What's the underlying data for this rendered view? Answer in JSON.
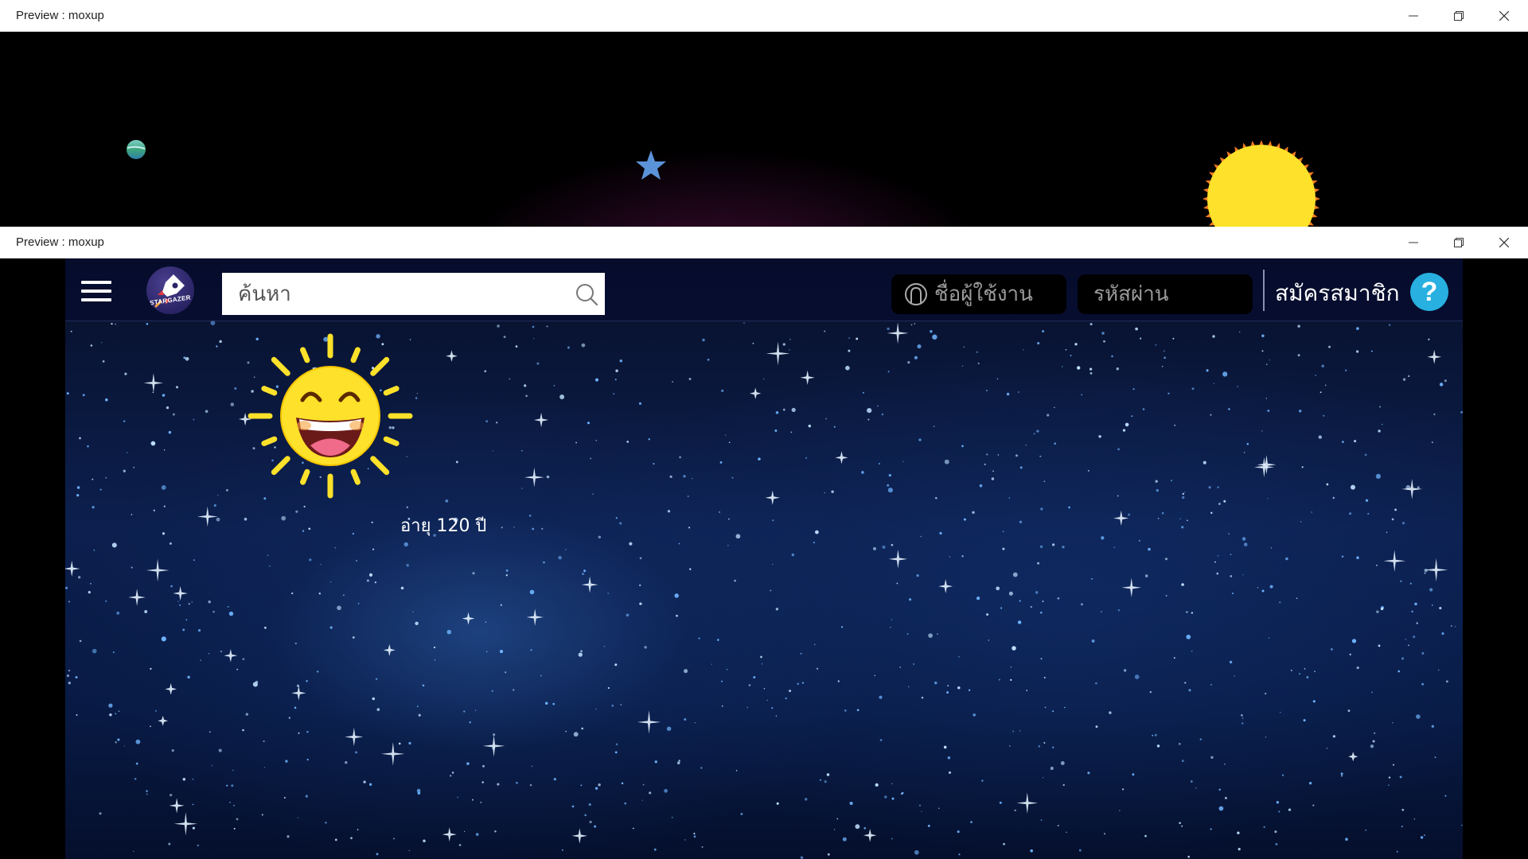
{
  "windows": {
    "background": {
      "title": "Preview : moxup"
    },
    "main": {
      "title": "Preview : moxup"
    }
  },
  "navbar": {
    "menu_icon": "hamburger-icon",
    "logo_text": "STARGAZER",
    "search": {
      "placeholder": "ค้นหา",
      "value": "",
      "icon": "search-icon"
    },
    "username": {
      "placeholder": "ชื่อผู้ใช้งาน",
      "icon": "user-icon"
    },
    "password": {
      "placeholder": "รหัสผ่าน"
    },
    "register_label": "สมัครสมาชิก",
    "help_label": "?"
  },
  "content": {
    "age_label": "อายุ 120 ปี",
    "character": "laughing-sun"
  },
  "colors": {
    "accent_help": "#27b0e0",
    "sun_yellow": "#fde12a",
    "space_dark": "#08102a"
  }
}
